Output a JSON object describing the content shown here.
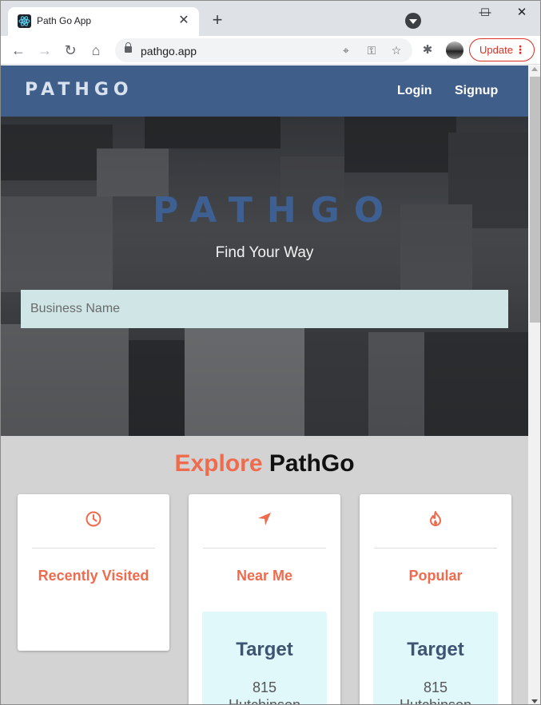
{
  "browser": {
    "tab_title": "Path Go App",
    "url": "pathgo.app",
    "update_label": "Update"
  },
  "nav": {
    "logo": "PATHGO",
    "login": "Login",
    "signup": "Signup",
    "bg_color": "#3f5e8a"
  },
  "hero": {
    "logo": "PATHGO",
    "tagline": "Find Your Way",
    "search_placeholder": "Business Name"
  },
  "explore": {
    "accent": "Explore",
    "rest": "PathGo",
    "accent_color": "#ee6b4d"
  },
  "cards": [
    {
      "icon": "clock-icon",
      "title": "Recently Visited"
    },
    {
      "icon": "location-arrow-icon",
      "title": "Near Me",
      "result": {
        "name": "Target",
        "addr1": "815",
        "addr2": "Hutchinson"
      }
    },
    {
      "icon": "fire-icon",
      "title": "Popular",
      "result": {
        "name": "Target",
        "addr1": "815",
        "addr2": "Hutchinson"
      }
    }
  ]
}
